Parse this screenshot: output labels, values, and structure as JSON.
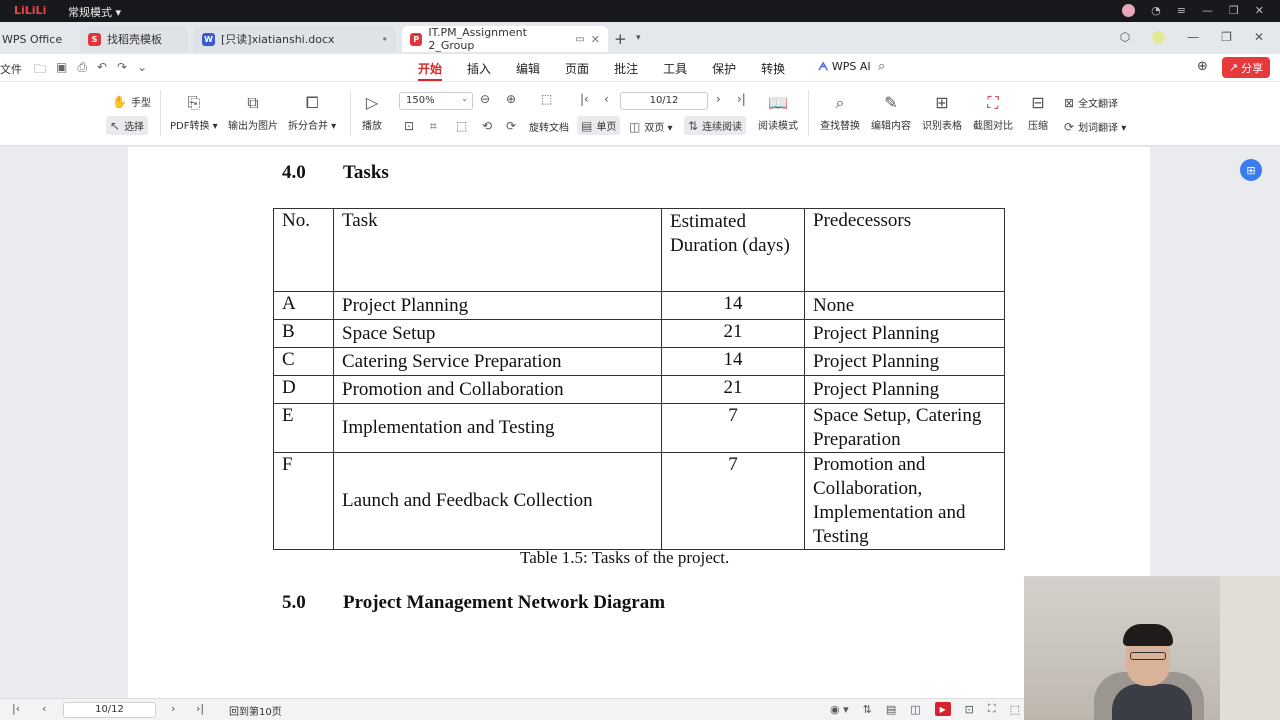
{
  "topstrip": {
    "logo": "LiLiLi",
    "mode": "常规模式 ▾"
  },
  "tabs": {
    "home": "WPS Office",
    "t1": "找稻壳模板",
    "t2": "[只读]xiatianshi.docx",
    "t3": "IT.PM_Assignment 2_Group",
    "t1_icon_color": "#e0353a",
    "t2_icon_color": "#3a5ccc",
    "t3_icon_color": "#e0353a"
  },
  "menubar": {
    "file": "文件",
    "menus": [
      "开始",
      "插入",
      "编辑",
      "页面",
      "批注",
      "工具",
      "保护",
      "转换"
    ],
    "wps_ai": "WPS AI",
    "share": "分享"
  },
  "toolbar": {
    "hand": "手型",
    "select": "选择",
    "pdf_convert": "PDF转换",
    "export_image": "输出为图片",
    "split_merge": "拆分合并",
    "play": "播放",
    "zoom": "150%",
    "page_box": "10/12",
    "rotate": "旋转文档",
    "single": "单页",
    "double": "双页",
    "continuous": "连续阅读",
    "read_mode": "阅读模式",
    "find_replace": "查找替换",
    "edit_content": "编辑内容",
    "recognize_table": "识别表格",
    "screenshot_compare": "截图对比",
    "compress": "压缩",
    "full_translate": "全文翻译",
    "word_translate": "划词翻译"
  },
  "document": {
    "section4_num": "4.0",
    "section4_title": "Tasks",
    "table": {
      "headers": [
        "No.",
        "Task",
        "Estimated Duration (days)",
        "Predecessors"
      ],
      "rows": [
        {
          "no": "A",
          "task": "Project Planning",
          "duration": "14",
          "pred": "None"
        },
        {
          "no": "B",
          "task": "Space Setup",
          "duration": "21",
          "pred": "Project Planning"
        },
        {
          "no": "C",
          "task": "Catering Service Preparation",
          "duration": "14",
          "pred": "Project Planning"
        },
        {
          "no": "D",
          "task": "Promotion and Collaboration",
          "duration": "21",
          "pred": "Project Planning"
        },
        {
          "no": "E",
          "task": "Implementation and Testing",
          "duration": "7",
          "pred": "Space Setup, Catering Preparation"
        },
        {
          "no": "F",
          "task": "Launch and Feedback Collection",
          "duration": "7",
          "pred": "Promotion and Collaboration, Implementation and Testing"
        }
      ]
    },
    "caption": "Table 1.5: Tasks of the project.",
    "section5_num": "5.0",
    "section5_title": "Project Management Network Diagram"
  },
  "statusbar": {
    "page": "10/12",
    "back": "回到第10页"
  }
}
